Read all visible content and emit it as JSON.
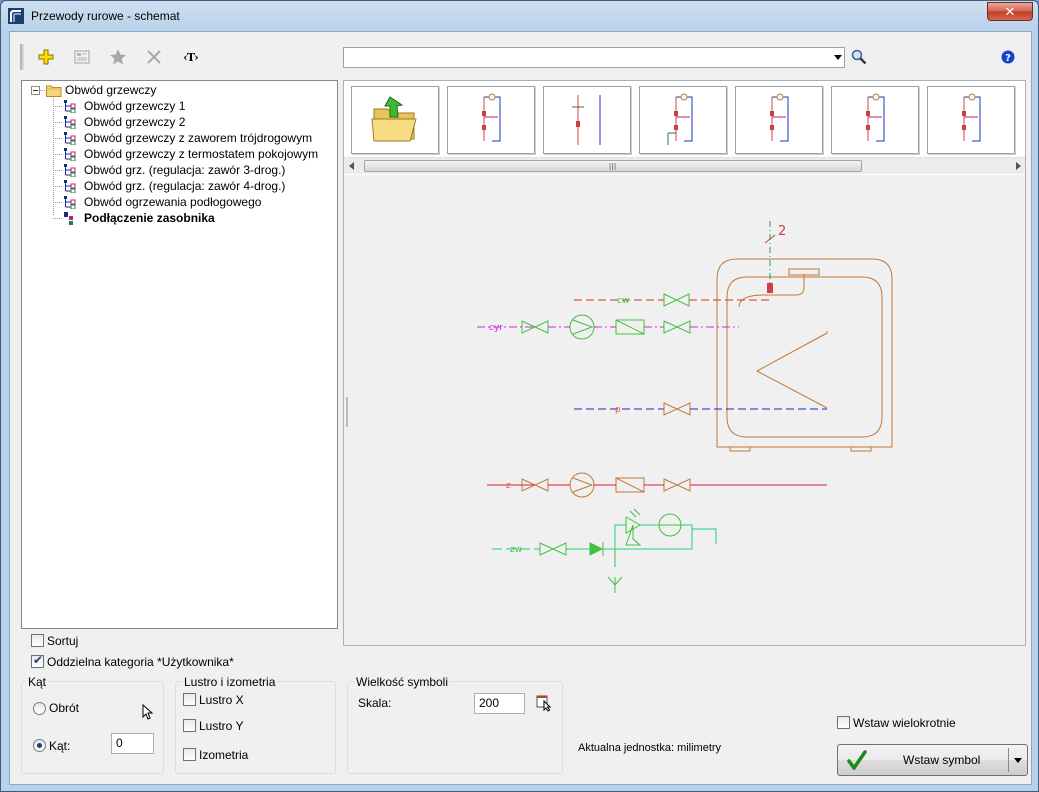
{
  "window": {
    "title": "Przewody rurowe - schemat",
    "close_label": "✕"
  },
  "toolbar": {
    "search_value": "",
    "text_tool_label": "‹T›"
  },
  "tree": {
    "root": "Obwód grzewczy",
    "items": [
      "Obwód grzewczy 1",
      "Obwód grzewczy 2",
      "Obwód grzewczy z zaworem trójdrogowym",
      "Obwód grzewczy z termostatem pokojowym",
      "Obwód grz. (regulacja: zawór 3-drog.)",
      "Obwód grz. (regulacja: zawór 4-drog.)",
      "Obwód ogrzewania podłogowego",
      "Podłączenie zasobnika"
    ],
    "selected_index": 7
  },
  "scheme": {
    "label_2": "2",
    "cw": "cw",
    "cyr": "cyr",
    "p": "p",
    "z": "z",
    "zw": "zw",
    "colors": {
      "tank": "#c07838",
      "cw": "#e03020",
      "cyr": "#e020e0",
      "p": "#2020d0",
      "z": "#d02040",
      "zw": "#20d080",
      "symbols": "#40c040"
    }
  },
  "options": {
    "sort_label": "Sortuj",
    "sort_checked": false,
    "separate_label": "Oddzielna kategoria *Użytkownika*",
    "separate_checked": true
  },
  "angle_group": {
    "title": "Kąt",
    "rotation_label": "Obrót",
    "angle_label": "Kąt:",
    "angle_value": "0"
  },
  "mirror_group": {
    "title": "Lustro i izometria",
    "mirror_x": "Lustro X",
    "mirror_y": "Lustro Y",
    "isometry": "Izometria"
  },
  "size_group": {
    "title": "Wielkość symboli",
    "scale_label": "Skala:",
    "scale_value": "200"
  },
  "current_unit": "Aktualna jednostka: milimetry",
  "insert_multiple_label": "Wstaw wielokrotnie",
  "insert_button_label": "Wstaw symbol"
}
